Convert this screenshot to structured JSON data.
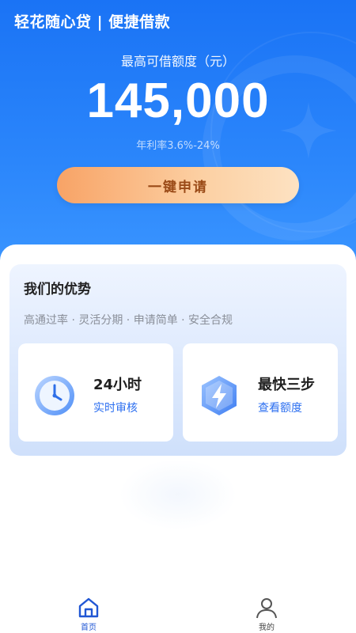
{
  "header": {
    "app_title": "轻花随心贷 | 便捷借款",
    "limit_label": "最高可借额度（元）",
    "limit_amount": "145,000",
    "rate_text": "年利率3.6%-24%",
    "apply_button": "一键申请"
  },
  "advantages": {
    "title": "我们的优势",
    "tags": "高通过率 · 灵活分期 · 申请简单 · 安全合规",
    "features": [
      {
        "title": "24小时",
        "subtitle": "实时审核",
        "icon": "clock-icon"
      },
      {
        "title": "最快三步",
        "subtitle": "查看额度",
        "icon": "lightning-icon"
      }
    ]
  },
  "tabbar": {
    "items": [
      {
        "label": "首页",
        "icon": "home-icon",
        "active": true
      },
      {
        "label": "我的",
        "icon": "user-icon",
        "active": false
      }
    ]
  },
  "colors": {
    "primary": "#1a73f5",
    "button_start": "#f8a366",
    "button_end": "#fde2c2",
    "accent_text": "#2c6ff0"
  }
}
